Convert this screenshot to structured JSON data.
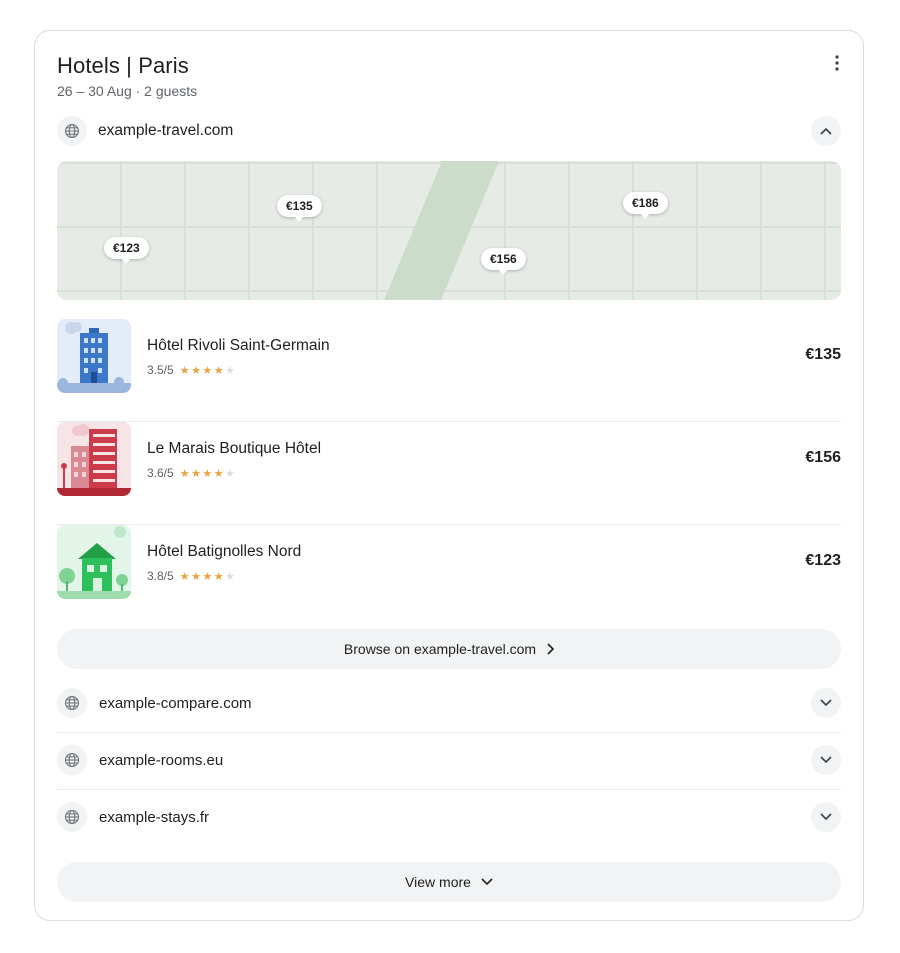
{
  "header": {
    "title": "Hotels | Paris",
    "subtitle": "26 – 30 Aug · 2 guests",
    "more_icon": "more-vert-icon"
  },
  "primary_site": {
    "name": "example-travel.com",
    "icon": "globe-icon",
    "expanded": true
  },
  "map": {
    "pins": [
      {
        "label": "€135"
      },
      {
        "label": "€186"
      },
      {
        "label": "€123"
      },
      {
        "label": "€156"
      }
    ]
  },
  "hotels": [
    {
      "name": "Hôtel Rivoli Saint-Germain",
      "rating": "3.5/5",
      "stars": 4,
      "price": "€135",
      "accent": "#3b78c8"
    },
    {
      "name": "Le Marais Boutique Hôtel",
      "rating": "3.6/5",
      "stars": 4,
      "price": "€156",
      "accent": "#cc3b4a"
    },
    {
      "name": "Hôtel Batignolles Nord",
      "rating": "3.8/5",
      "stars": 4,
      "price": "€123",
      "accent": "#2ea84f"
    }
  ],
  "browse_button": {
    "label": "Browse on example-travel.com",
    "icon": "chevron-right-icon"
  },
  "other_sites": [
    {
      "name": "example-compare.com",
      "icon": "globe-icon"
    },
    {
      "name": "example-rooms.eu",
      "icon": "globe-icon"
    },
    {
      "name": "example-stays.fr",
      "icon": "globe-icon"
    }
  ],
  "view_more": {
    "label": "View more",
    "icon": "chevron-down-icon"
  },
  "colors": {
    "star": "#e8a33d",
    "star_empty": "#dadce0",
    "map_bg": "#e6ebe6",
    "pill_bg": "#f1f3f4"
  }
}
